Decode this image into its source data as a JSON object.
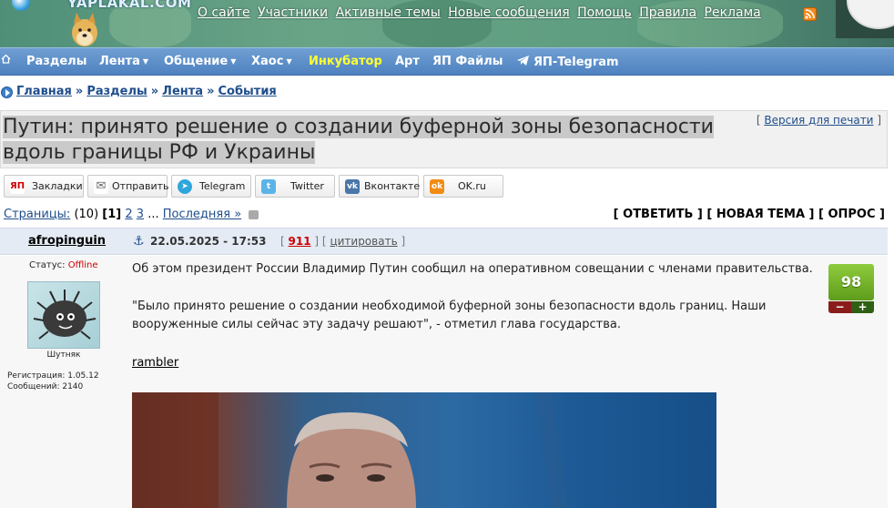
{
  "header": {
    "logo_text": "YAPLAKAL.COM",
    "top_links": [
      "О сайте",
      "Участники",
      "Активные темы",
      "Новые сообщения",
      "Помощь",
      "Правила",
      "Реклама"
    ],
    "rss_icon": "rss-icon"
  },
  "nav": {
    "home_icon": "home-icon",
    "items": [
      "Разделы",
      "Лента",
      "Общение",
      "Хаос",
      "Инкубатор",
      "Арт",
      "ЯП Файлы",
      "ЯП-Telegram"
    ],
    "dropdown_arrow": "▼",
    "highlight_color": "#ffff33"
  },
  "breadcrumb": {
    "items": [
      "Главная",
      "Разделы",
      "Лента",
      "События"
    ],
    "separator": "»"
  },
  "topic": {
    "title": "Путин: принято решение о создании буферной зоны безопасности вдоль границы РФ и Украины",
    "print_version": "Версия для печати",
    "bracket_open": "[",
    "bracket_close": "]"
  },
  "share": {
    "buttons": [
      {
        "label": "Закладки",
        "icon": "ЯП"
      },
      {
        "label": "Отправить",
        "icon": "✉"
      },
      {
        "label": "Telegram",
        "icon": "➤"
      },
      {
        "label": "Twitter",
        "icon": "t"
      },
      {
        "label": "Вконтакте",
        "icon": "vk"
      },
      {
        "label": "OK.ru",
        "icon": "ok"
      }
    ]
  },
  "pagination": {
    "label": "Страницы:",
    "total": "(10)",
    "current": "[1]",
    "pages": [
      "2",
      "3"
    ],
    "ellipsis": "...",
    "last": "Последняя »"
  },
  "actions": "[ ОТВЕТИТЬ ] [ НОВАЯ ТЕМА ] [ ОПРОС ]",
  "post": {
    "author": "afropinguin",
    "date": "22.05.2025 - 17:53",
    "number": "911",
    "quote": "цитировать",
    "status_label": "Статус:",
    "status_value": "Offline",
    "rank": "Шутняк",
    "registration": "Регистрация: 1.05.12",
    "messages": "Сообщений: 2140",
    "paragraph1": "Об этом президент России Владимир Путин сообщил на оперативном совещании с членами правительства.",
    "paragraph2_line1": "\"Было принято решение о создании необходимой буферной зоны безопасности вдоль границ. Наши",
    "paragraph2_line2": "вооруженные силы сейчас эту задачу решают\", - отметил глава государства.",
    "source": "rambler",
    "rating": "98",
    "minus": "−",
    "plus": "+"
  }
}
